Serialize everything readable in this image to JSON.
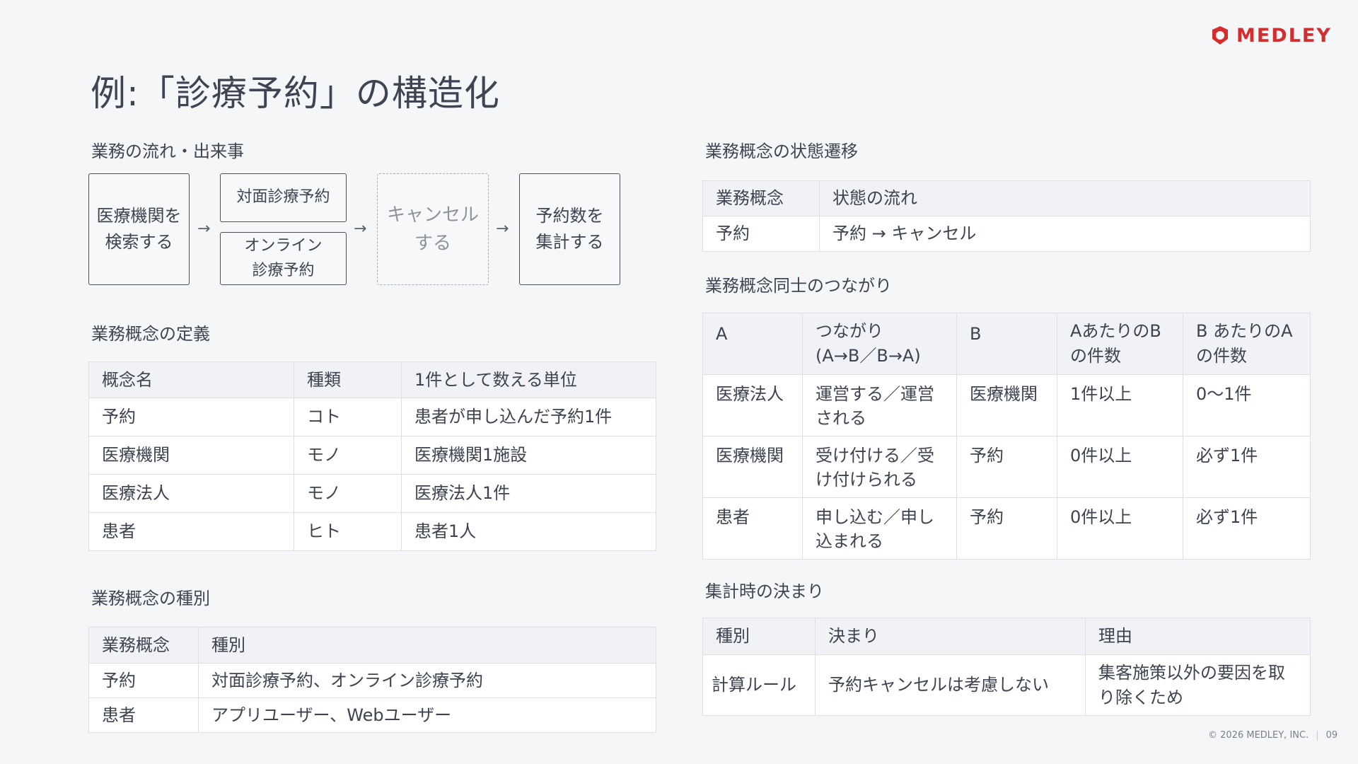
{
  "brand": {
    "name": "MEDLEY",
    "color": "#d52d2d",
    "icon": "medley-logo-icon"
  },
  "title": "例:「診療予約」の構造化",
  "flow": {
    "heading": "業務の流れ・出来事",
    "steps": {
      "search": "医療機関を\n検索する",
      "inperson": "対面診療予約",
      "online": "オンライン\n診療予約",
      "cancel": "キャンセル\nする",
      "count": "予約数を\n集計する"
    },
    "arrow": "→"
  },
  "definitions": {
    "heading": "業務概念の定義",
    "headers": [
      "概念名",
      "種類",
      "1件として数える単位"
    ],
    "rows": [
      [
        "予約",
        "コト",
        "患者が申し込んだ予約1件"
      ],
      [
        "医療機関",
        "モノ",
        "医療機関1施設"
      ],
      [
        "医療法人",
        "モノ",
        "医療法人1件"
      ],
      [
        "患者",
        "ヒト",
        "患者1人"
      ]
    ]
  },
  "types": {
    "heading": "業務概念の種別",
    "headers": [
      "業務概念",
      "種別"
    ],
    "rows": [
      [
        "予約",
        "対面診療予約、オンライン診療予約"
      ],
      [
        "患者",
        "アプリユーザー、Webユーザー"
      ]
    ]
  },
  "states": {
    "heading": "業務概念の状態遷移",
    "headers": [
      "業務概念",
      "状態の流れ"
    ],
    "rows": [
      [
        "予約",
        "予約 → キャンセル"
      ]
    ]
  },
  "relations": {
    "heading": "業務概念同士のつながり",
    "headers": [
      "A",
      "つながり\n(A→B／B→A)",
      "B",
      "AあたりのB\nの件数",
      "B あたりのA\nの件数"
    ],
    "rows": [
      [
        "医療法人",
        "運営する／運営\nされる",
        "医療機関",
        "1件以上",
        "0〜1件"
      ],
      [
        "医療機関",
        "受け付ける／受\nけ付けられる",
        "予約",
        "0件以上",
        "必ず1件"
      ],
      [
        "患者",
        "申し込む／申し\n込まれる",
        "予約",
        "0件以上",
        "必ず1件"
      ]
    ]
  },
  "rules": {
    "heading": "集計時の決まり",
    "headers": [
      "種別",
      "決まり",
      "理由"
    ],
    "rows": [
      [
        "計算ルール",
        "予約キャンセルは考慮しない",
        "集客施策以外の要因を取\nり除くため"
      ]
    ]
  },
  "footer": {
    "copyright": "© 2026 MEDLEY, INC.",
    "page": "09"
  }
}
